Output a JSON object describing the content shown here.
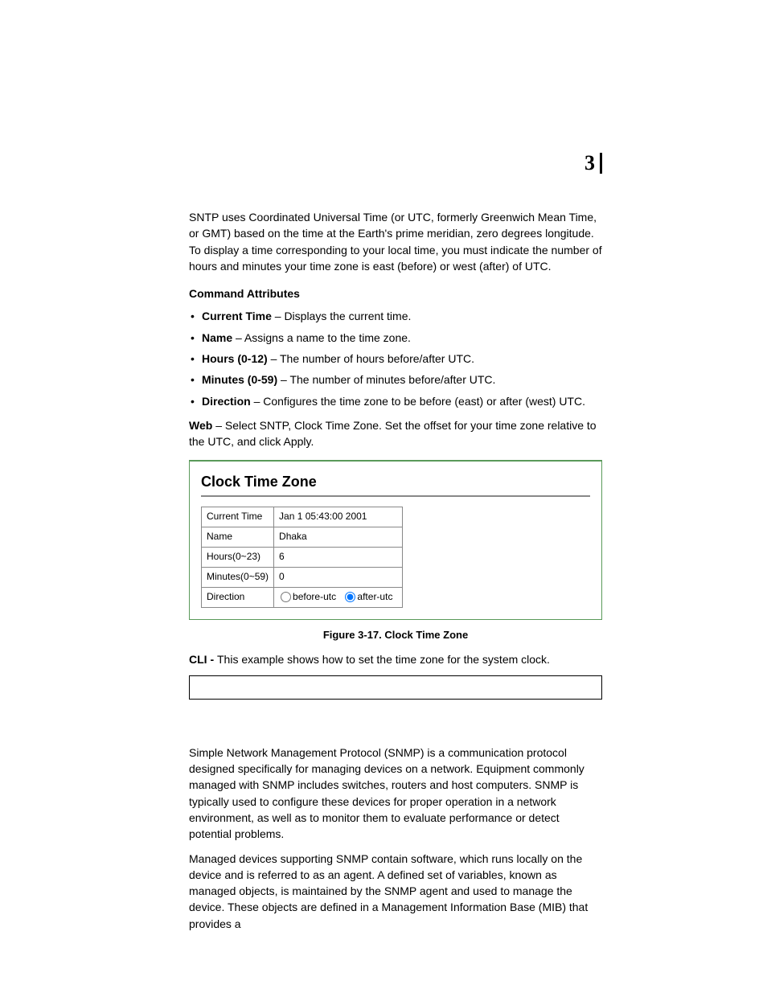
{
  "chapter_number": "3",
  "intro_paragraph": "SNTP uses Coordinated Universal Time (or UTC, formerly Greenwich Mean Time, or GMT) based on the time at the Earth's prime meridian, zero degrees longitude. To display a time corresponding to your local time, you must indicate the number of hours and minutes your time zone is east (before) or west (after) of UTC.",
  "command_attributes_heading": "Command Attributes",
  "attributes": [
    {
      "name": "Current Time",
      "desc": " – Displays the current time."
    },
    {
      "name": "Name",
      "desc": " – Assigns a name to the time zone."
    },
    {
      "name": "Hours (0-12)",
      "desc": " – The number of hours before/after UTC."
    },
    {
      "name": "Minutes (0-59)",
      "desc": " – The number of minutes before/after UTC."
    },
    {
      "name": "Direction",
      "desc": " – Configures the time zone to be before (east) or after (west) UTC."
    }
  ],
  "web_label": "Web",
  "web_text": " – Select SNTP, Clock Time Zone. Set the offset for your time zone relative to the UTC, and click Apply.",
  "figure": {
    "panel_title": "Clock Time Zone",
    "rows": {
      "current_time_label": "Current Time",
      "current_time_value": "Jan 1 05:43:00 2001",
      "name_label": "Name",
      "name_value": "Dhaka",
      "hours_label": "Hours(0~23)",
      "hours_value": "6",
      "minutes_label": "Minutes(0~59)",
      "minutes_value": "0",
      "direction_label": "Direction",
      "direction_before": "before-utc",
      "direction_after": "after-utc",
      "direction_selected": "after-utc"
    },
    "caption": "Figure 3-17.  Clock Time Zone"
  },
  "cli_label": "CLI - ",
  "cli_text": "This example shows how to set the time zone for the system clock.",
  "snmp_p1": "Simple Network Management Protocol (SNMP) is a communication protocol designed specifically for managing devices on a network. Equipment commonly managed with SNMP includes switches, routers and host computers. SNMP is typically used to configure these devices for proper operation in a network environment, as well as to monitor them to evaluate performance or detect potential problems.",
  "snmp_p2": "Managed devices supporting SNMP contain software, which runs locally on the device and is referred to as an agent. A defined set of variables, known as managed objects, is maintained by the SNMP agent and used to manage the device. These objects are defined in a Management Information Base (MIB) that provides a"
}
